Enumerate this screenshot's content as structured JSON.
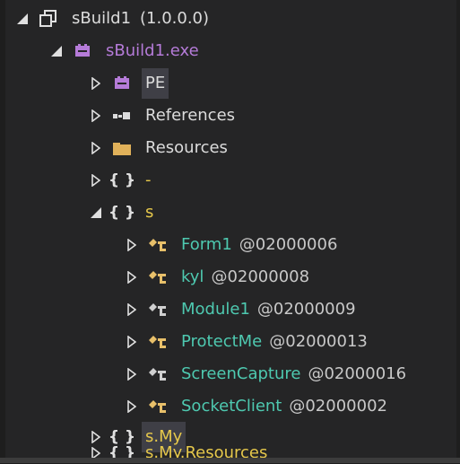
{
  "tree": {
    "assembly": {
      "name": "sBuild1",
      "version": "(1.0.0.0)"
    },
    "module": {
      "label": "sBuild1.exe"
    },
    "pe": {
      "label": "PE"
    },
    "references": {
      "label": "References"
    },
    "resources": {
      "label": "Resources"
    },
    "ns_dash": {
      "label": "-"
    },
    "ns_s": {
      "label": "s"
    },
    "types": [
      {
        "name": "Form1",
        "token": "@02000006"
      },
      {
        "name": "kyl",
        "token": "@02000008"
      },
      {
        "name": "Module1",
        "token": "@02000009"
      },
      {
        "name": "ProtectMe",
        "token": "@02000013"
      },
      {
        "name": "ScreenCapture",
        "token": "@02000016"
      },
      {
        "name": "SocketClient",
        "token": "@02000002"
      }
    ],
    "ns_smy": {
      "label": "s.My"
    },
    "ns_smy_res": {
      "label": "s.My.Resources"
    }
  },
  "colors": {
    "background": "#252526",
    "namespace": "#e6c84b",
    "type": "#4ec9b0",
    "module": "#b57bd8",
    "selection": "#3f3f46"
  }
}
